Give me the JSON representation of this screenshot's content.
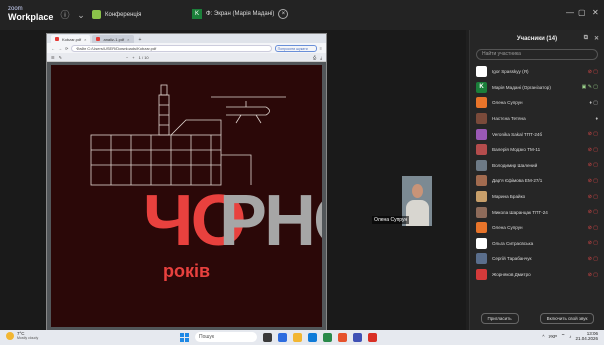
{
  "zoom": {
    "brand_top": "zoom",
    "brand_bottom": "Workplace",
    "conference_label": "Конференція",
    "share_avatar": "K",
    "share_label": "Ф: Экран (Марія Мадані)"
  },
  "browser": {
    "tabs": [
      {
        "label": "Kobzar.pdf"
      },
      {
        "label": "analiz-1.pdf"
      }
    ],
    "address": "Файл  C:/Users/USER/Downloads/Kobzar.pdf",
    "search_placeholder": "Попросити шукати",
    "page_indicator": "1 / 10",
    "zoom_level": "100%"
  },
  "document": {
    "line1_red": "ЧО",
    "line1_gray": "РНО",
    "line2": "років"
  },
  "self_view": {
    "name": "Олена Супрун"
  },
  "participants": {
    "title": "Учасники (14)",
    "search_placeholder": "Найти участника",
    "items": [
      {
        "name": "Igor Spasskyy (Я)",
        "avatar_color": "#ffffff",
        "initial": "",
        "status": "muted"
      },
      {
        "name": "Марія Мадані (Організатор)",
        "avatar_color": "#1b7f3a",
        "initial": "K",
        "status": "host"
      },
      {
        "name": "Олена Супрун",
        "avatar_color": "#e8742a",
        "initial": "",
        "status": "active"
      },
      {
        "name": "Настєна Тетяна",
        "avatar_color": "#7a4a3a",
        "initial": "",
        "status": "mic"
      },
      {
        "name": "Veronika Sakal ТПТ-24б",
        "avatar_color": "#9b59b6",
        "initial": "",
        "status": "muted"
      },
      {
        "name": "Валерія Модзко ТМ-11",
        "avatar_color": "#b44c4c",
        "initial": "",
        "status": "muted"
      },
      {
        "name": "Володимир Шалений",
        "avatar_color": "#6d7a86",
        "initial": "",
        "status": "muted"
      },
      {
        "name": "Дар'я Єфімова ЕМ-27/1",
        "avatar_color": "#a26b4f",
        "initial": "",
        "status": "muted"
      },
      {
        "name": "Марина Брайко",
        "avatar_color": "#c89f6a",
        "initial": "",
        "status": "muted"
      },
      {
        "name": "Микола Шаранцак ТПТ-24",
        "avatar_color": "#8e6b5a",
        "initial": "",
        "status": "muted"
      },
      {
        "name": "Олена Супрун",
        "avatar_color": "#e8742a",
        "initial": "",
        "status": "muted"
      },
      {
        "name": "Ольга Ситрасвська",
        "avatar_color": "#ffffff",
        "initial": "",
        "status": "muted"
      },
      {
        "name": "Сергій Тарабанчук",
        "avatar_color": "#5a6e8c",
        "initial": "",
        "status": "muted"
      },
      {
        "name": "Жорняков Дмитро",
        "avatar_color": "#d43a3a",
        "initial": "",
        "status": "muted"
      }
    ],
    "invite_label": "Пригласить",
    "unmute_label": "Включить свой звук"
  },
  "taskbar": {
    "temperature": "7°C",
    "weather": "Mostly cloudy",
    "search_placeholder": "Пошук",
    "time": "13:06",
    "date": "21.04.2026",
    "lang": "УКР"
  }
}
